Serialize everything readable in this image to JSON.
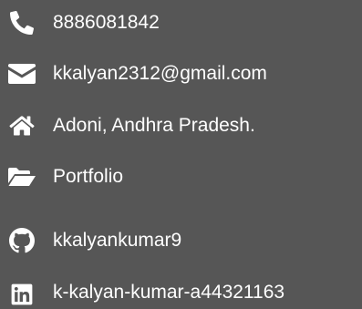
{
  "contacts": {
    "phone": {
      "icon": "phone-icon",
      "text": "8886081842"
    },
    "email": {
      "icon": "envelope-icon",
      "text": "kkalyan2312@gmail.com"
    },
    "location": {
      "icon": "home-icon",
      "text": "Adoni, Andhra Pradesh."
    },
    "portfolio": {
      "icon": "folder-open-icon",
      "text": "Portfolio"
    },
    "github": {
      "icon": "github-icon",
      "text": "kkalyankumar9"
    },
    "linkedin": {
      "icon": "linkedin-icon",
      "text": "k-kalyan-kumar-a44321163"
    }
  },
  "colors": {
    "background": "#565656",
    "text": "#ffffff"
  }
}
